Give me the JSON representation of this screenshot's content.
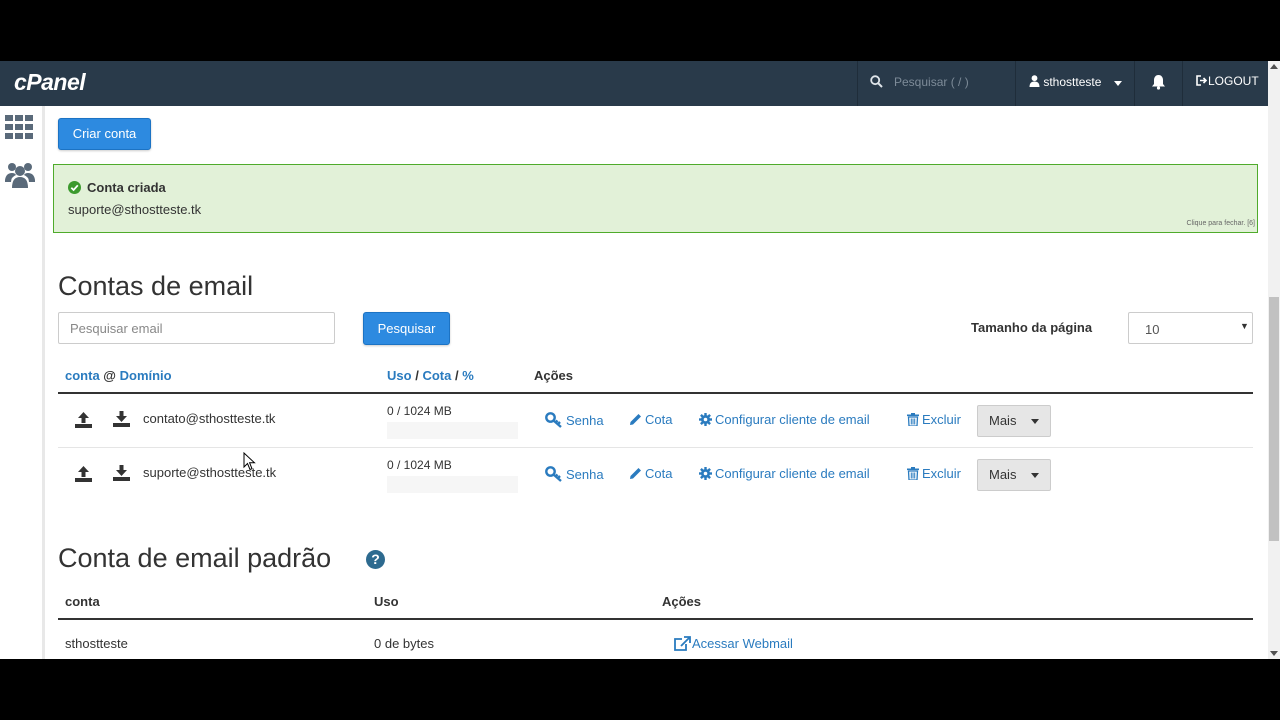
{
  "navbar": {
    "logo": "cPanel",
    "search_placeholder": "Pesquisar ( / )",
    "username": "sthostteste",
    "logout": "LOGOUT"
  },
  "toolbar": {
    "create_account": "Criar conta"
  },
  "alert": {
    "title": "Conta criada",
    "message": "suporte@sthostteste.tk",
    "close_hint": "Clique para fechar. [6]"
  },
  "email_accounts": {
    "title": "Contas de email",
    "search_placeholder": "Pesquisar email",
    "search_button": "Pesquisar",
    "page_size_label": "Tamanho da página",
    "page_size_value": "10",
    "columns": {
      "account": "conta",
      "at": "@",
      "domain": "Domínio",
      "usage": "Uso",
      "sep1": "/",
      "quota": "Cota",
      "sep2": "/",
      "percent": "%",
      "actions": "Ações"
    },
    "rows": [
      {
        "email": "contato@sthostteste.tk",
        "usage": "0 / 1024 MB",
        "usage_fraction": 0
      },
      {
        "email": "suporte@sthostteste.tk",
        "usage": "0 / 1024 MB",
        "usage_fraction": 0
      }
    ],
    "row_actions": {
      "password": "Senha",
      "quota": "Cota",
      "configure": "Configurar cliente de email",
      "delete": "Excluir",
      "more": "Mais"
    }
  },
  "default_account": {
    "title": "Conta de email padrão",
    "columns": {
      "account": "conta",
      "usage": "Uso",
      "actions": "Ações"
    },
    "row": {
      "account": "sthostteste",
      "usage": "0 de bytes",
      "action": "Acessar Webmail"
    }
  },
  "colors": {
    "navbar": "#293a4a",
    "primary": "#2d8ae0",
    "link": "#2a7bbf",
    "alert_bg": "#e2f1d8",
    "alert_border": "#4fab2b"
  }
}
